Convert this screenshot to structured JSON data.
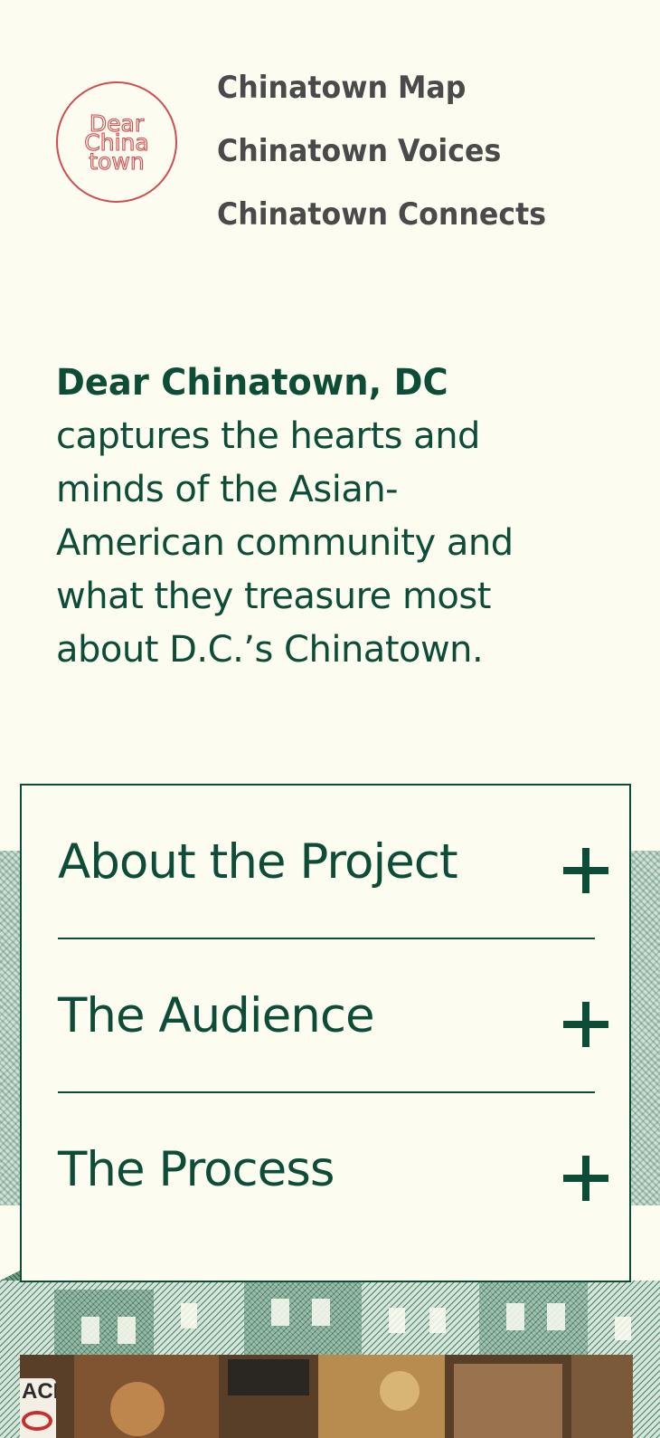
{
  "logo": {
    "lines": [
      "Dear",
      "China",
      "town"
    ],
    "colors": {
      "stroke": "#cf4d4f"
    }
  },
  "nav": {
    "items": [
      {
        "label": "Chinatown Map"
      },
      {
        "label": "Chinatown Voices"
      },
      {
        "label": "Chinatown Connects"
      }
    ]
  },
  "intro": {
    "title": "Dear Chinatown, DC",
    "body": "captures the hearts and\nminds of the Asian-\nAmerican community and\nwhat they treasure most\nabout D.C.’s Chinatown."
  },
  "accordion": {
    "items": [
      {
        "label": "About the Project",
        "icon": "plus-icon"
      },
      {
        "label": "The Audience",
        "icon": "plus-icon"
      },
      {
        "label": "The Process",
        "icon": "plus-icon"
      }
    ]
  },
  "photo": {
    "sign_text": "ACK"
  },
  "colors": {
    "background": "#fcfcf1",
    "accent_green": "#0d4d38",
    "nav_text": "#4b4a4a",
    "logo_red": "#cf4d4f"
  }
}
